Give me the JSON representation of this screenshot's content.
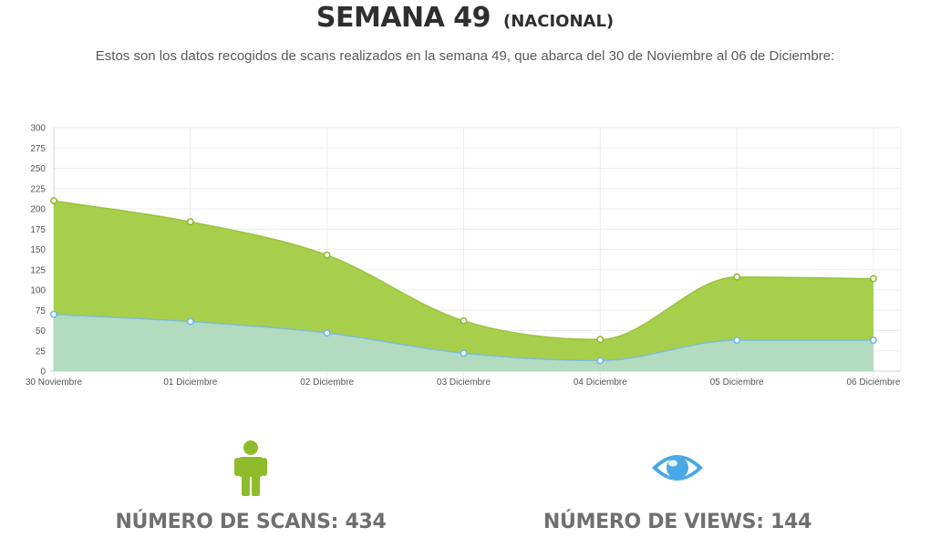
{
  "header": {
    "title": "SEMANA 49",
    "subtitle": "(NACIONAL)",
    "description": "Estos son los datos recogidos de scans realizados en la semana 49, que abarca del 30 de Noviembre al 06 de Diciembre:"
  },
  "chart_data": {
    "type": "area",
    "categories": [
      "30 Noviembre",
      "01 Diciembre",
      "02 Diciembre",
      "03 Diciembre",
      "04 Diciembre",
      "05 Diciembre",
      "06 Diciembre"
    ],
    "series": [
      {
        "values": [
          210,
          184,
          143,
          62,
          39,
          116,
          114
        ],
        "color": "#a8cf4c",
        "point_color": "#8fbc2b"
      },
      {
        "values": [
          70,
          61,
          47,
          22,
          13,
          38,
          38
        ],
        "color": "#b3dbbf",
        "point_color": "#6fb8ee"
      }
    ],
    "ylim": [
      0,
      300
    ],
    "yticks": [
      0,
      25,
      50,
      75,
      100,
      125,
      150,
      175,
      200,
      225,
      250,
      275,
      300
    ],
    "grid": true
  },
  "stats": {
    "scans": {
      "label": "NÚMERO DE SCANS: 434",
      "icon": "person-icon",
      "color": "#8fbc2b"
    },
    "views": {
      "label": "NÚMERO DE VIEWS: 144",
      "icon": "eye-icon",
      "color": "#4aa8e6"
    }
  }
}
